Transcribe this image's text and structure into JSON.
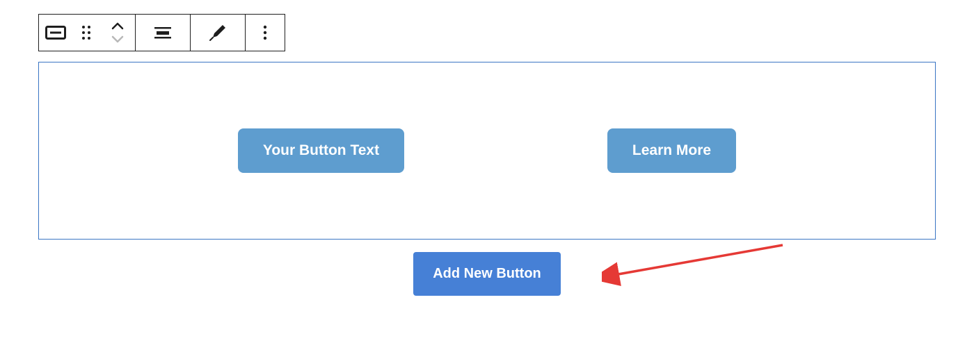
{
  "toolbar": {
    "icons": {
      "block_type": "button-block-icon",
      "drag": "drag-handle-icon",
      "move": "move-up-down-icon",
      "align": "align-center-icon",
      "style": "style-brush-icon",
      "more": "more-options-icon"
    }
  },
  "block": {
    "buttons": [
      {
        "label": "Your Button Text"
      },
      {
        "label": "Learn More"
      }
    ]
  },
  "actions": {
    "add_new": "Add New Button"
  }
}
